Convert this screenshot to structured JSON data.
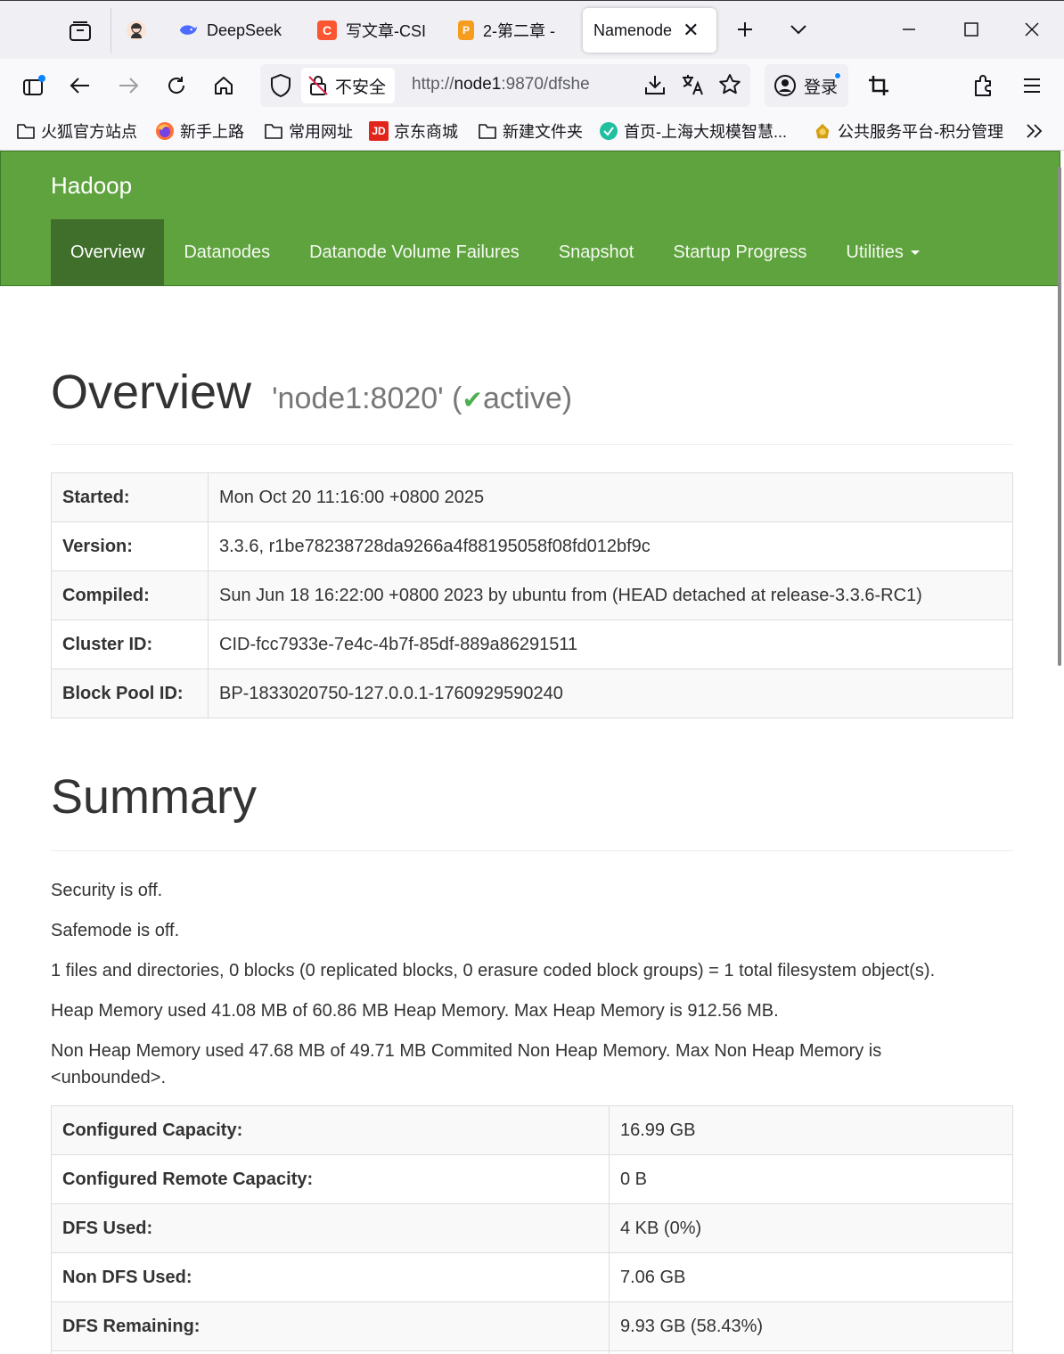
{
  "browser": {
    "tabs": [
      {
        "title": "DeepSeek"
      },
      {
        "title": "写文章-CSI"
      },
      {
        "title": "2-第二章 -"
      },
      {
        "title": "Namenode"
      }
    ],
    "address": {
      "security_label": "不安全",
      "url_prefix": "http://",
      "url_host": "node1",
      "url_rest": ":9870/dfshe"
    },
    "login_label": "登录",
    "bookmarks": [
      {
        "label": "火狐官方站点"
      },
      {
        "label": "新手上路"
      },
      {
        "label": "常用网址"
      },
      {
        "label": "京东商城"
      },
      {
        "label": "新建文件夹"
      },
      {
        "label": "首页-上海大规模智慧..."
      },
      {
        "label": "公共服务平台-积分管理"
      }
    ]
  },
  "hadoop_nav": {
    "brand": "Hadoop",
    "items": [
      {
        "label": "Overview",
        "active": true
      },
      {
        "label": "Datanodes"
      },
      {
        "label": "Datanode Volume Failures"
      },
      {
        "label": "Snapshot"
      },
      {
        "label": "Startup Progress"
      },
      {
        "label": "Utilities"
      }
    ]
  },
  "overview": {
    "title": "Overview",
    "host": "'node1:8020'",
    "status_open": "(",
    "status": "active",
    "status_close": ")",
    "rows": [
      {
        "key": "Started:",
        "value": "Mon Oct 20 11:16:00 +0800 2025"
      },
      {
        "key": "Version:",
        "value": "3.3.6, r1be78238728da9266a4f88195058f08fd012bf9c"
      },
      {
        "key": "Compiled:",
        "value": "Sun Jun 18 16:22:00 +0800 2023 by ubuntu from (HEAD detached at release-3.3.6-RC1)"
      },
      {
        "key": "Cluster ID:",
        "value": "CID-fcc7933e-7e4c-4b7f-85df-889a86291511"
      },
      {
        "key": "Block Pool ID:",
        "value": "BP-1833020750-127.0.0.1-1760929590240"
      }
    ]
  },
  "summary": {
    "title": "Summary",
    "lines": [
      "Security is off.",
      "Safemode is off.",
      "1 files and directories, 0 blocks (0 replicated blocks, 0 erasure coded block groups) = 1 total filesystem object(s).",
      "Heap Memory used 41.08 MB of 60.86 MB Heap Memory. Max Heap Memory is 912.56 MB.",
      "Non Heap Memory used 47.68 MB of 49.71 MB Commited Non Heap Memory. Max Non Heap Memory is <unbounded>."
    ],
    "rows": [
      {
        "key": "Configured Capacity:",
        "value": "16.99 GB"
      },
      {
        "key": "Configured Remote Capacity:",
        "value": "0 B"
      },
      {
        "key": "DFS Used:",
        "value": "4 KB (0%)"
      },
      {
        "key": "Non DFS Used:",
        "value": "7.06 GB"
      },
      {
        "key": "DFS Remaining:",
        "value": "9.93 GB (58.43%)"
      }
    ]
  },
  "colors": {
    "hadoop_green": "#5fa33e",
    "nav_active": "#3f6f2a",
    "active_check": "#4cae4c"
  }
}
